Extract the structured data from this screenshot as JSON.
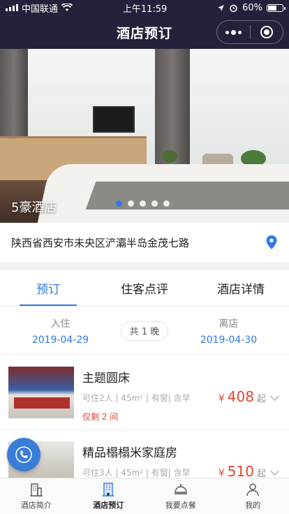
{
  "status_bar": {
    "carrier": "中国联通",
    "time": "上午11:59",
    "battery": "60%"
  },
  "nav": {
    "title": "酒店预订"
  },
  "banner": {
    "hotel_name": "5豪酒店",
    "pages": 5,
    "active_page": 1
  },
  "address": {
    "text": "陕西省西安市未央区浐灞半岛金茂七路"
  },
  "tabs": [
    {
      "label": "预订"
    },
    {
      "label": "住客点评"
    },
    {
      "label": "酒店详情"
    }
  ],
  "booking": {
    "checkin_label": "入住",
    "checkin_date": "2019-04-29",
    "nights": "共 1 晚",
    "checkout_label": "离店",
    "checkout_date": "2019-04-30"
  },
  "rooms": [
    {
      "name": "主题圆床",
      "meta": "可住2人 | 45m² | 有窗| 含早",
      "remaining": "仅剩 2 间",
      "currency": "¥",
      "price": "408",
      "from": "起"
    },
    {
      "name": "精品榻榻米家庭房",
      "meta": "可住3人 | 45m² | 有窗| 含早",
      "currency": "¥",
      "price": "510",
      "from": "起"
    }
  ],
  "tabbar": [
    {
      "label": "酒店简介",
      "icon": "building-icon"
    },
    {
      "label": "酒店预订",
      "icon": "hotel-icon"
    },
    {
      "label": "我要点餐",
      "icon": "dish-cover-icon"
    },
    {
      "label": "我的",
      "icon": "user-icon"
    }
  ],
  "colors": {
    "accent": "#2c7be5",
    "price": "#e2442f",
    "nav_bg": "#22223a"
  }
}
